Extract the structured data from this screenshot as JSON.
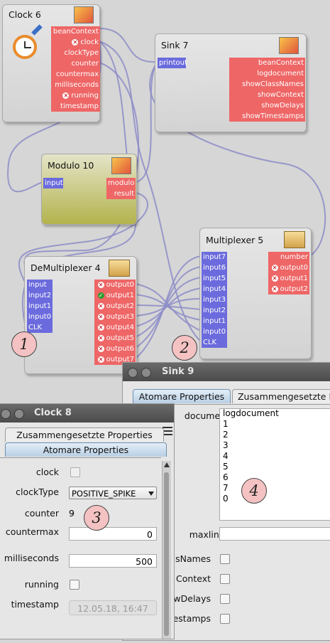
{
  "nodes": {
    "clock": {
      "title": "Clock 6",
      "outputs": [
        "beanContext",
        "clock",
        "clockType",
        "counter",
        "countermax",
        "milliseconds",
        "running",
        "timestamp"
      ]
    },
    "sink": {
      "title": "Sink 7",
      "inputs": [
        "printout"
      ],
      "outputs": [
        "beanContext",
        "logdocument",
        "showClassNames",
        "showContext",
        "showDelays",
        "showTimestamps"
      ]
    },
    "modulo": {
      "title": "Modulo 10",
      "inputs": [
        "input"
      ],
      "outputs": [
        "modulo",
        "result"
      ]
    },
    "demux": {
      "title": "DeMultiplexer 4",
      "inputs": [
        "input",
        "input2",
        "input1",
        "input0",
        "CLK"
      ],
      "outputs": [
        "output0",
        "output1",
        "output2",
        "output3",
        "output4",
        "output5",
        "output6",
        "output7"
      ]
    },
    "mux": {
      "title": "Multiplexer 5",
      "inputs": [
        "input7",
        "input6",
        "input5",
        "input4",
        "input3",
        "input2",
        "input1",
        "input0",
        "CLK"
      ],
      "outputs": [
        "number",
        "output0",
        "output1",
        "output2"
      ]
    }
  },
  "badges": [
    "1",
    "2",
    "3",
    "4"
  ],
  "sink_window": {
    "title": "Sink 9",
    "tabs": [
      "Atomare Properties",
      "Zusammengesetzte P"
    ],
    "labels": [
      "document",
      "maxlines",
      "sNames",
      "Context",
      "wDelays",
      "estamps"
    ],
    "logdocument": [
      "logdocument",
      "1",
      "2",
      "3",
      "4",
      "5",
      "6",
      "7",
      "0"
    ],
    "maxlines_value": ""
  },
  "clock_window": {
    "title": "Clock 8",
    "tabs": [
      "Zusammengesetzte Properties",
      "Atomare Properties"
    ],
    "labels": {
      "clock": "clock",
      "clockType": "clockType",
      "counter": "counter",
      "countermax": "countermax",
      "milliseconds": "milliseconds",
      "running": "running",
      "timestamp": "timestamp"
    },
    "clockType_value": "POSITIVE_SPIKE",
    "counter_value": "9",
    "countermax_value": "0",
    "milliseconds_value": "500",
    "timestamp_value": "12.05.18, 16:47"
  }
}
